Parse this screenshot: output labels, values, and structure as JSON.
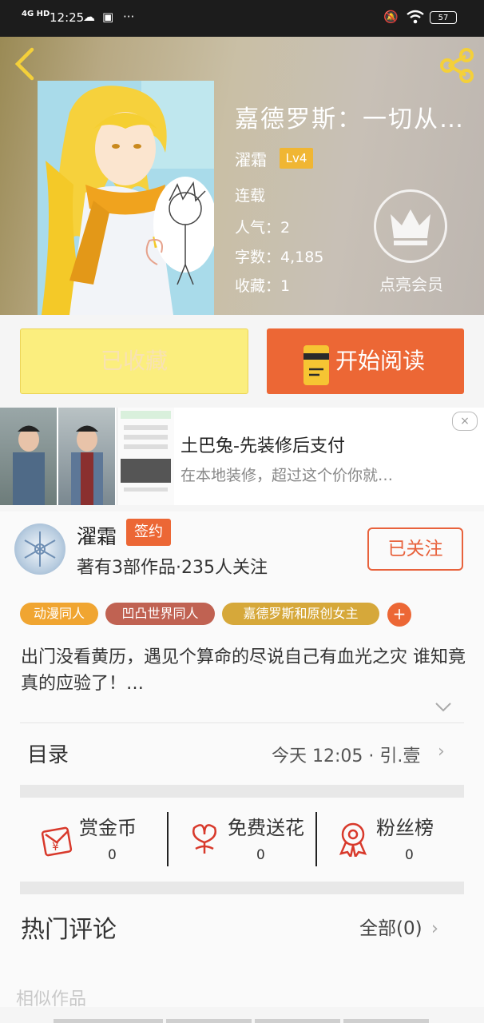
{
  "status_bar": {
    "network": "4G HD",
    "time": "12:25",
    "dots": "···",
    "battery": "57"
  },
  "book": {
    "title": "嘉德罗斯：一切从…",
    "author": "濯霜",
    "level": "Lv4",
    "status": "连载",
    "popularity": "人气：2",
    "words": "字数：4,185",
    "favorites": "收藏：1",
    "vip_label": "点亮会员"
  },
  "actions": {
    "collect_label": "已收藏",
    "read_label": "开始阅读"
  },
  "ad": {
    "title": "土巴兔-先装修后支付",
    "description": "在本地装修，超过这个价你就…",
    "close": "×"
  },
  "author_info": {
    "name": "濯霜",
    "signed_badge": "签约",
    "stats": "著有3部作品·235人关注",
    "follow_label": "已关注"
  },
  "tags": [
    {
      "label": "动漫同人",
      "color": "#f0a531"
    },
    {
      "label": "凹凸世界同人",
      "color": "#c06252"
    },
    {
      "label": "嘉德罗斯和原创女主",
      "color": "#d6a83a"
    }
  ],
  "tag_add": "+",
  "synopsis": "出门没看黄历，遇见个算命的尽说自己有血光之灾 谁知竟真的应验了！…",
  "toc": {
    "label": "目录",
    "latest": "今天 12:05 · 引.壹",
    "chevron": "›"
  },
  "rewards": [
    {
      "label": "赏金币",
      "value": "0",
      "icon": "red-envelope-icon"
    },
    {
      "label": "免费送花",
      "value": "0",
      "icon": "flower-icon"
    },
    {
      "label": "粉丝榜",
      "value": "0",
      "icon": "medal-icon"
    }
  ],
  "comments": {
    "label": "热门评论",
    "all_label": "全部(0)"
  },
  "similar_label": "相似作品",
  "colors": {
    "accent": "#ec6735",
    "collect_bg": "#fbee7e",
    "level_badge": "#f0b633"
  }
}
